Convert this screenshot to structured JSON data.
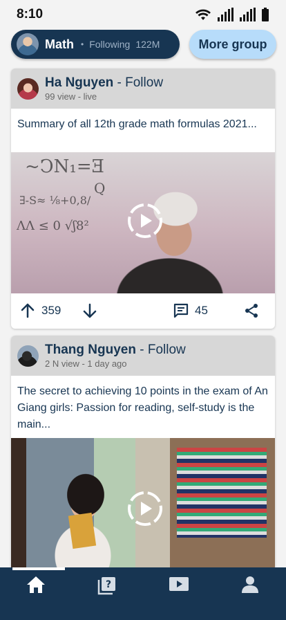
{
  "status_bar": {
    "time": "8:10"
  },
  "group": {
    "name": "Math",
    "following_label": "Following",
    "following_count": "122M",
    "more_button": "More group"
  },
  "posts": [
    {
      "author": "Ha Nguyen",
      "follow_label": "- Follow",
      "meta": "99 view - live",
      "text": "Summary of all 12th grade math formulas 2021...",
      "upvotes": "359",
      "comments": "45"
    },
    {
      "author": "Thang Nguyen",
      "follow_label": "- Follow",
      "meta": "2 N view - 1 day ago",
      "text": "The secret to achieving 10 points in the exam of An Giang girls: Passion for reading, self-study is the main..."
    }
  ],
  "nav": {
    "items": [
      "home-icon",
      "question-book-icon",
      "video-icon",
      "profile-icon"
    ],
    "active_index": 0
  },
  "colors": {
    "primary": "#173552",
    "accent_light": "#b7dcfa",
    "header_gray": "#d7d7d7"
  }
}
